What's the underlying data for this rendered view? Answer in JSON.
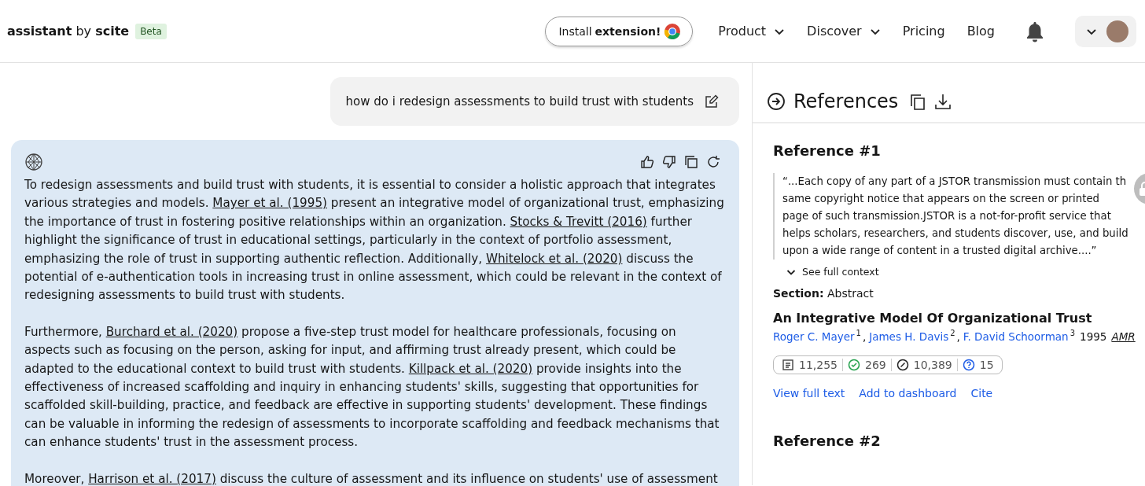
{
  "header": {
    "brand": {
      "name": "assistant",
      "by": "by",
      "product": "scite",
      "badge": "Beta"
    },
    "install_button": {
      "text": "Install",
      "bold": "extension!"
    },
    "nav": [
      {
        "label": "Product",
        "dropdown": true
      },
      {
        "label": "Discover",
        "dropdown": true
      },
      {
        "label": "Pricing",
        "dropdown": false
      },
      {
        "label": "Blog",
        "dropdown": false
      }
    ]
  },
  "chat": {
    "question": "how do i redesign assessments to build trust with students",
    "answer": [
      [
        {
          "kind": "text",
          "text": "To redesign assessments and build trust with students, it is essential to consider a holistic approach that integrates various strategies and models. "
        },
        {
          "kind": "link",
          "text": "Mayer et al. (1995)"
        },
        {
          "kind": "text",
          "text": " present an integrative model of organizational trust, emphasizing the importance of trust in fostering positive relationships within an organization. "
        },
        {
          "kind": "link",
          "text": "Stocks & Trevitt (2016)"
        },
        {
          "kind": "text",
          "text": " further highlight the significance of trust in educational settings, particularly in the context of portfolio assessment, emphasizing the role of trust in supporting authentic reflection. Additionally, "
        },
        {
          "kind": "link",
          "text": "Whitelock et al. (2020)"
        },
        {
          "kind": "text",
          "text": " discuss the potential of e-authentication tools in increasing trust in online assessment, which could be relevant in the context of redesigning assessments to build trust with students."
        }
      ],
      [
        {
          "kind": "text",
          "text": "Furthermore, "
        },
        {
          "kind": "link",
          "text": "Burchard et al. (2020)"
        },
        {
          "kind": "text",
          "text": " propose a five-step trust model for healthcare professionals, focusing on aspects such as focusing on the person, asking for input, and affirming trust already present, which could be adapted to the educational context to build trust with students. "
        },
        {
          "kind": "link",
          "text": "Killpack et al. (2020)"
        },
        {
          "kind": "text",
          "text": " provide insights into the effectiveness of increased scaffolding and inquiry in enhancing students' skills, suggesting that opportunities for scaffolded skill-building, practice, and feedback are effective in supporting students' development. These findings can be valuable in informing the redesign of assessments to incorporate scaffolding and feedback mechanisms that can enhance students' trust in the assessment process."
        }
      ],
      [
        {
          "kind": "text",
          "text": "Moreover, "
        },
        {
          "kind": "link",
          "text": "Harrison et al. (2017)"
        },
        {
          "kind": "text",
          "text": " discuss the culture of assessment and its influence on students' use of assessment"
        }
      ]
    ]
  },
  "references": {
    "title": "References",
    "items": [
      {
        "heading": "Reference #1",
        "quote": "“...Each copy of any part of a JSTOR transmission must contain th same copyright notice that appears on the screen or printed page of such transmission.JSTOR is a not-for-profit service that helps scholars, researchers, and students discover, use, and build upon a wide range of content in a trusted digital archive....”",
        "context_toggle": "See full context",
        "section_label": "Section:",
        "section": "Abstract",
        "title": "An Integrative Model Of Organizational Trust",
        "authors": [
          {
            "name": "Roger C. Mayer",
            "sup": "1"
          },
          {
            "name": "James H. Davis",
            "sup": "2"
          },
          {
            "name": "F. David Schoorman",
            "sup": "3"
          }
        ],
        "author_separator": ",",
        "year": "1995",
        "journal": "AMR",
        "metrics": [
          {
            "kind": "publications",
            "value": "11,255"
          },
          {
            "kind": "supporting",
            "value": "269"
          },
          {
            "kind": "mentioning",
            "value": "10,389"
          },
          {
            "kind": "contrasting",
            "value": "15"
          }
        ],
        "actions": [
          "View full text",
          "Add to dashboard",
          "Cite"
        ]
      },
      {
        "heading": "Reference #2"
      }
    ]
  }
}
